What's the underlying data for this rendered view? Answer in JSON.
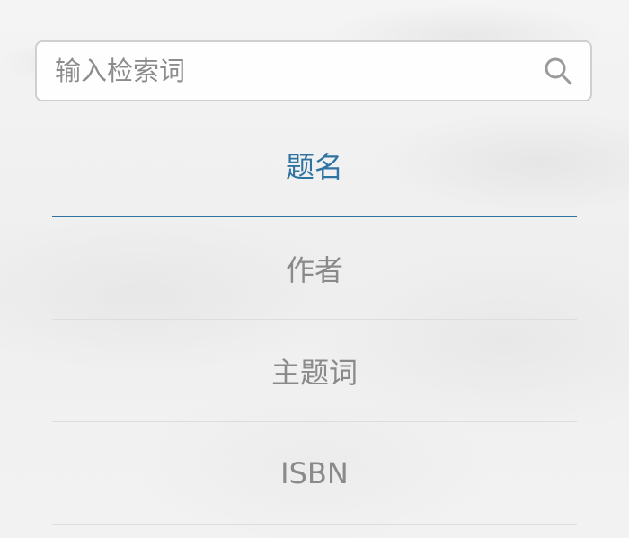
{
  "search": {
    "placeholder": "输入检索词",
    "icon": "search-icon"
  },
  "tabs": [
    {
      "label": "题名",
      "active": true
    },
    {
      "label": "作者",
      "active": false
    },
    {
      "label": "主题词",
      "active": false
    },
    {
      "label": "ISBN",
      "active": false
    }
  ],
  "colors": {
    "active_text": "#2f73a3",
    "inactive_text": "#8a8a8a",
    "border": "#cfcfcf",
    "divider": "#dddddd"
  }
}
